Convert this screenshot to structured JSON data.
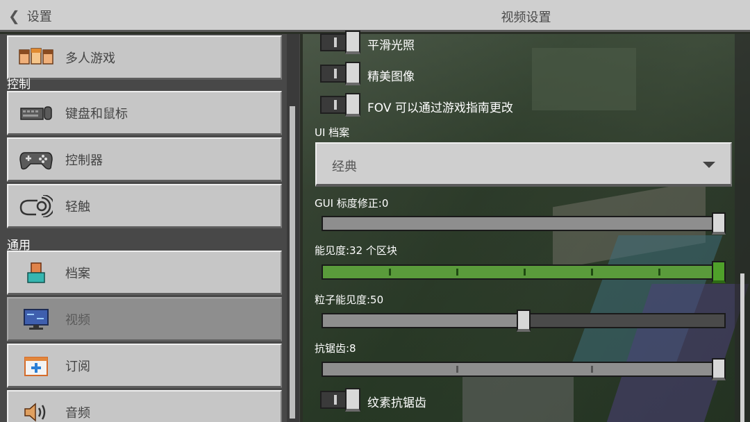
{
  "header": {
    "back_label": "设置",
    "title": "视频设置"
  },
  "sidebar": {
    "sections": {
      "controls": "控制",
      "general": "通用"
    },
    "items": [
      {
        "label": "多人游戏",
        "icon": "multiplayer-icon"
      },
      {
        "label": "键盘和鼠标",
        "icon": "keyboard-mouse-icon"
      },
      {
        "label": "控制器",
        "icon": "controller-icon"
      },
      {
        "label": "轻触",
        "icon": "touch-icon"
      },
      {
        "label": "档案",
        "icon": "profile-icon"
      },
      {
        "label": "视频",
        "icon": "monitor-icon",
        "selected": true
      },
      {
        "label": "订阅",
        "icon": "subscription-icon"
      },
      {
        "label": "音频",
        "icon": "speaker-icon"
      }
    ]
  },
  "settings": {
    "smooth_lighting": {
      "label": "平滑光照",
      "on": false
    },
    "fancy_graphics": {
      "label": "精美图像",
      "on": false
    },
    "fov_toggle": {
      "label": "FOV 可以通过游戏指南更改",
      "on": false
    },
    "ui_profile": {
      "label": "UI 档案",
      "value": "经典"
    },
    "gui_scale": {
      "label": "GUI 标度修正:0",
      "fraction": 1.0
    },
    "render_distance": {
      "label": "能见度:32 个区块",
      "fraction": 1.0,
      "ticks": 5
    },
    "particle_visibility": {
      "label": "粒子能见度:50",
      "fraction": 0.5
    },
    "anti_aliasing": {
      "label": "抗锯齿:8",
      "fraction": 1.0,
      "ticks": 2
    },
    "texture_aa": {
      "label": "纹素抗锯齿",
      "on": false
    }
  },
  "colors": {
    "accent_green": "#5a9b3b",
    "button_gray": "#c6c6c6",
    "selected_gray": "#8e8e8e"
  }
}
